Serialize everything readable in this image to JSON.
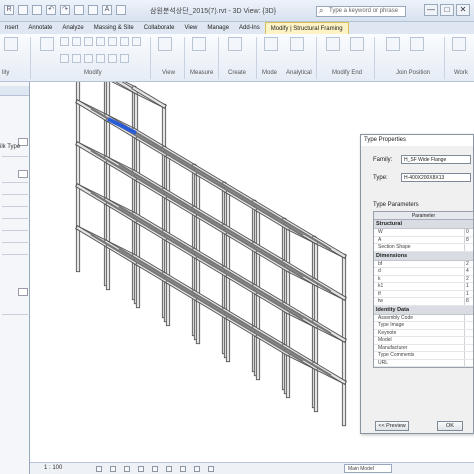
{
  "titlebar": {
    "title": "삼원분석상단_2015(7).rvt - 3D View: {3D}",
    "search_placeholder": "Type a keyword or phrase",
    "window_buttons": [
      "—",
      "□",
      "✕"
    ]
  },
  "ribbon": {
    "tabs": [
      "nsert",
      "Annotate",
      "Analyze",
      "Massing & Site",
      "Collaborate",
      "View",
      "Manage",
      "Add-Ins",
      "Modify | Structural Framing"
    ],
    "active_tab_index": 8,
    "panels": [
      "lity",
      "Modify",
      "View",
      "Measure",
      "Create",
      "Mode",
      "Analytical",
      "Modify End",
      "Join Position",
      "Work"
    ]
  },
  "left_panel": {
    "labels": [
      "ilk Type"
    ]
  },
  "dialog": {
    "title": "Type Properties",
    "family_label": "Family:",
    "family_value": "H_SF Wide Flange",
    "type_label": "Type:",
    "type_value": "H-400X200X8X13",
    "type_params_label": "Type Parameters",
    "param_header": "Parameter",
    "groups": [
      {
        "name": "Structural",
        "rows": [
          {
            "label": "W",
            "value": "0"
          },
          {
            "label": "A",
            "value": "8"
          },
          {
            "label": "Section Shape",
            "value": ""
          }
        ]
      },
      {
        "name": "Dimensions",
        "rows": [
          {
            "label": "bf",
            "value": "2"
          },
          {
            "label": "d",
            "value": "4"
          },
          {
            "label": "k",
            "value": "2"
          },
          {
            "label": "k1",
            "value": "1"
          },
          {
            "label": "tf",
            "value": "1"
          },
          {
            "label": "tw",
            "value": "8"
          }
        ]
      },
      {
        "name": "Identity Data",
        "rows": [
          {
            "label": "Assembly Code",
            "value": ""
          },
          {
            "label": "Type Image",
            "value": ""
          },
          {
            "label": "Keynote",
            "value": ""
          },
          {
            "label": "Model",
            "value": ""
          },
          {
            "label": "Manufacturer",
            "value": ""
          },
          {
            "label": "Type Comments",
            "value": ""
          },
          {
            "label": "URL",
            "value": ""
          }
        ]
      }
    ],
    "preview_button": "<< Preview",
    "ok_button": "OK"
  },
  "statusbar": {
    "scale": "1 : 100",
    "model_dropdown": "Main Model"
  },
  "colors": {
    "selected_beam": "#2a5bd7",
    "active_tab": "#fdf3c4"
  }
}
